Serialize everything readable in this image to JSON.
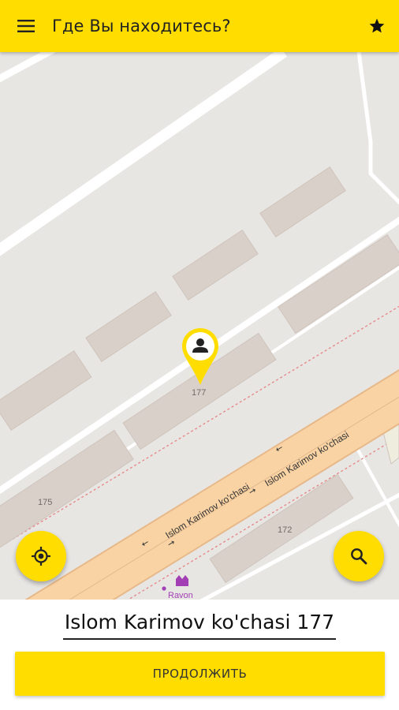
{
  "header": {
    "title": "Где Вы находитесь?",
    "menu_icon": "menu-icon",
    "favorites_icon": "star-icon"
  },
  "map": {
    "street_label_1": "Islom Karimov ko'chasi",
    "street_label_2": "Islom Karimov ko'chasi",
    "house_numbers": [
      "177",
      "175",
      "172"
    ],
    "poi_label": "Ravon",
    "poi_icon": "factory-icon",
    "marker_icon": "user-location-pin-icon"
  },
  "actions": {
    "locate_icon": "my-location-icon",
    "search_icon": "search-icon"
  },
  "footer": {
    "address": "Islom Karimov ko'chasi 177",
    "continue_label": "ПРОДОЛЖИТЬ"
  },
  "colors": {
    "accent": "#ffdd00",
    "map_background": "#e8e6e3",
    "building": "#d9d0c9",
    "road_major": "#f9d3a4",
    "road_minor": "#ffffff",
    "text": "#222222"
  }
}
